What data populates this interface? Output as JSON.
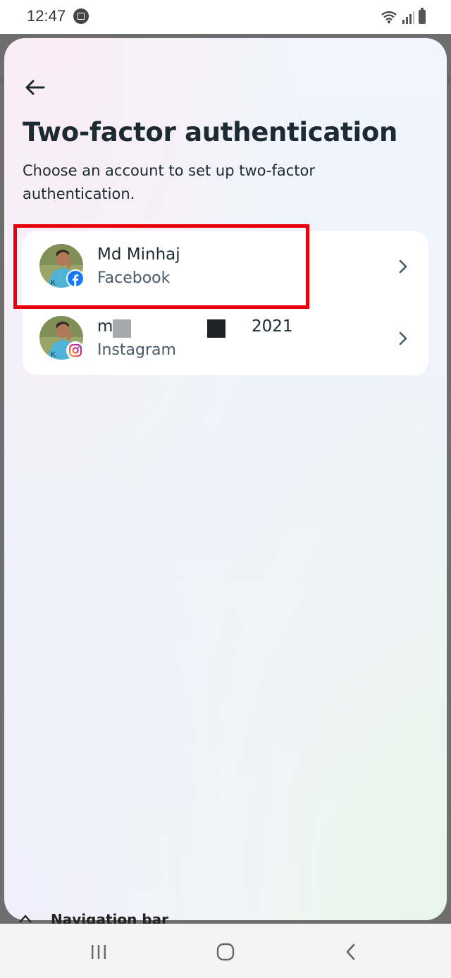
{
  "status_bar": {
    "time": "12:47"
  },
  "header": {
    "title": "Two-factor authentication",
    "subtitle": "Choose an account to set up two-factor authentication."
  },
  "accounts": [
    {
      "name": "Md Minhaj",
      "platform": "Facebook"
    },
    {
      "name_prefix": "m",
      "name_suffix": "2021",
      "platform": "Instagram"
    }
  ],
  "hint": {
    "text": "Navigation bar"
  },
  "colors": {
    "highlight": "#e8000b",
    "facebook": "#1877f2",
    "instagram": "#e1306c"
  }
}
